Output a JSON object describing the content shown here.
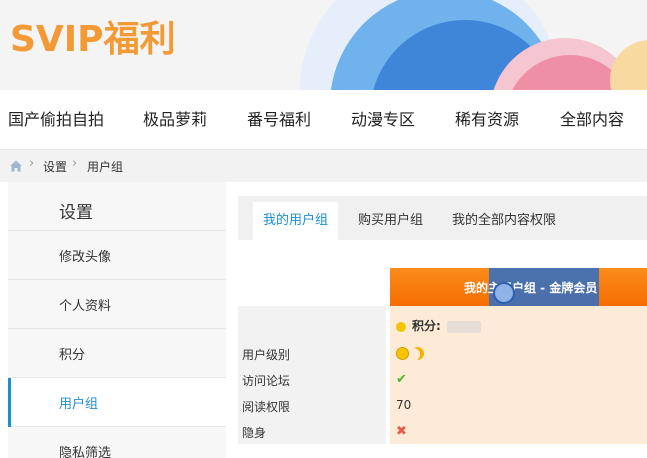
{
  "banner": {
    "logo_text": "SVIP福利"
  },
  "nav": {
    "items": [
      "国产偷拍自拍",
      "极品萝莉",
      "番号福利",
      "动漫专区",
      "稀有资源",
      "全部内容"
    ]
  },
  "breadcrumb": {
    "items": [
      "设置",
      "用户组"
    ]
  },
  "sidebar": {
    "title": "设置",
    "items": [
      "修改头像",
      "个人资料",
      "积分",
      "用户组",
      "隐私筛选"
    ],
    "active_index": 3
  },
  "tabs": {
    "items": [
      "我的用户组",
      "购买用户组",
      "我的全部内容权限"
    ],
    "active_index": 0
  },
  "group_card": {
    "title": "我的主用户组 - 金牌会员",
    "score_label": "积分:",
    "rows": [
      {
        "key": "用户级别",
        "value": "",
        "icon": "smile-moon-icon"
      },
      {
        "key": "访问论坛",
        "value": "",
        "icon": "check-icon"
      },
      {
        "key": "阅读权限",
        "value": "70",
        "icon": ""
      },
      {
        "key": "隐身",
        "value": "",
        "icon": "cross-icon"
      }
    ]
  },
  "colors": {
    "logo": "#f39a37",
    "accent": "#1a8fd6",
    "card_header": "#f56d00",
    "card_body": "#fdebd8"
  }
}
